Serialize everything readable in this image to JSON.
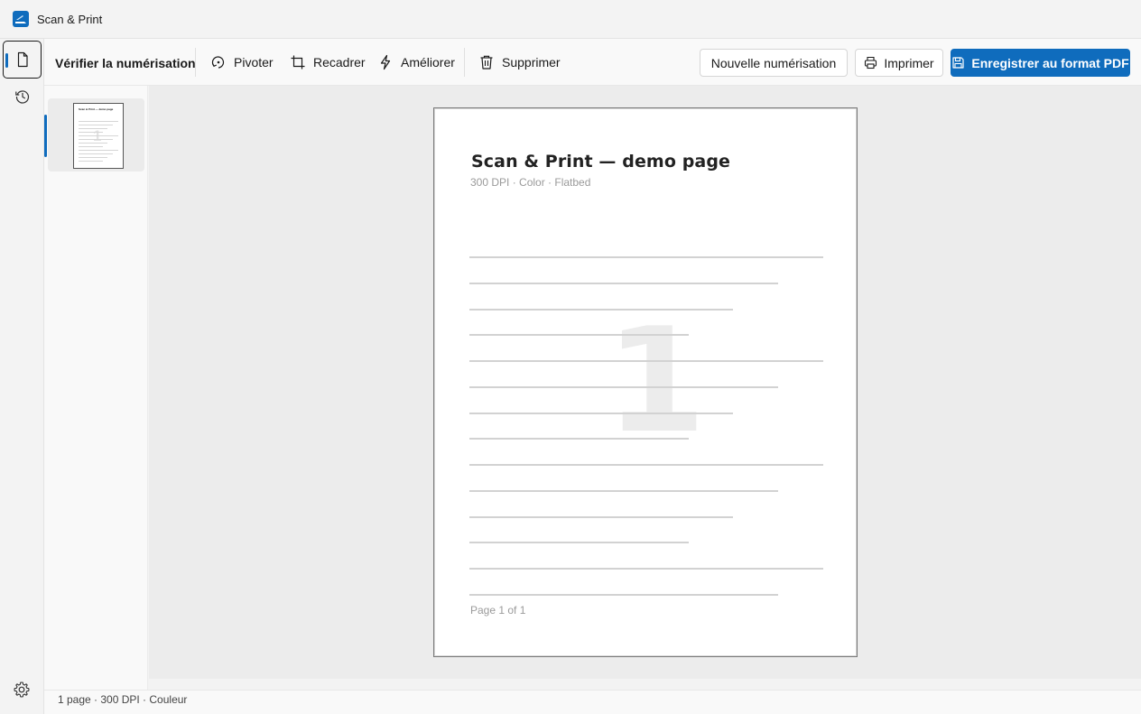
{
  "window": {
    "title": "Scan & Print",
    "icon": "scanner-icon"
  },
  "rail": {
    "items": [
      {
        "name": "document-icon",
        "active": true
      },
      {
        "name": "history-icon",
        "active": false
      }
    ],
    "settings_icon": "gear-icon"
  },
  "toolbar": {
    "title": "Vérifier la numérisation",
    "rotate_label": "Pivoter",
    "crop_label": "Recadrer",
    "enhance_label": "Améliorer",
    "delete_label": "Supprimer",
    "new_scan_label": "Nouvelle numérisation",
    "print_label": "Imprimer",
    "save_pdf_label": "Enregistrer au format PDF"
  },
  "thumbnails": [
    {
      "page_title": "Scan & Print — demo page",
      "page_number": "1",
      "selected": true
    }
  ],
  "page": {
    "title": "Scan & Print — demo page",
    "subtitle": "300 DPI · Color · Flatbed",
    "number": "1",
    "footer": "Page 1 of 1"
  },
  "status": {
    "text": "1 page · 300 DPI · Couleur"
  },
  "colors": {
    "accent": "#0f6cbd",
    "background": "#f3f3f3",
    "canvas": "#ececec"
  }
}
